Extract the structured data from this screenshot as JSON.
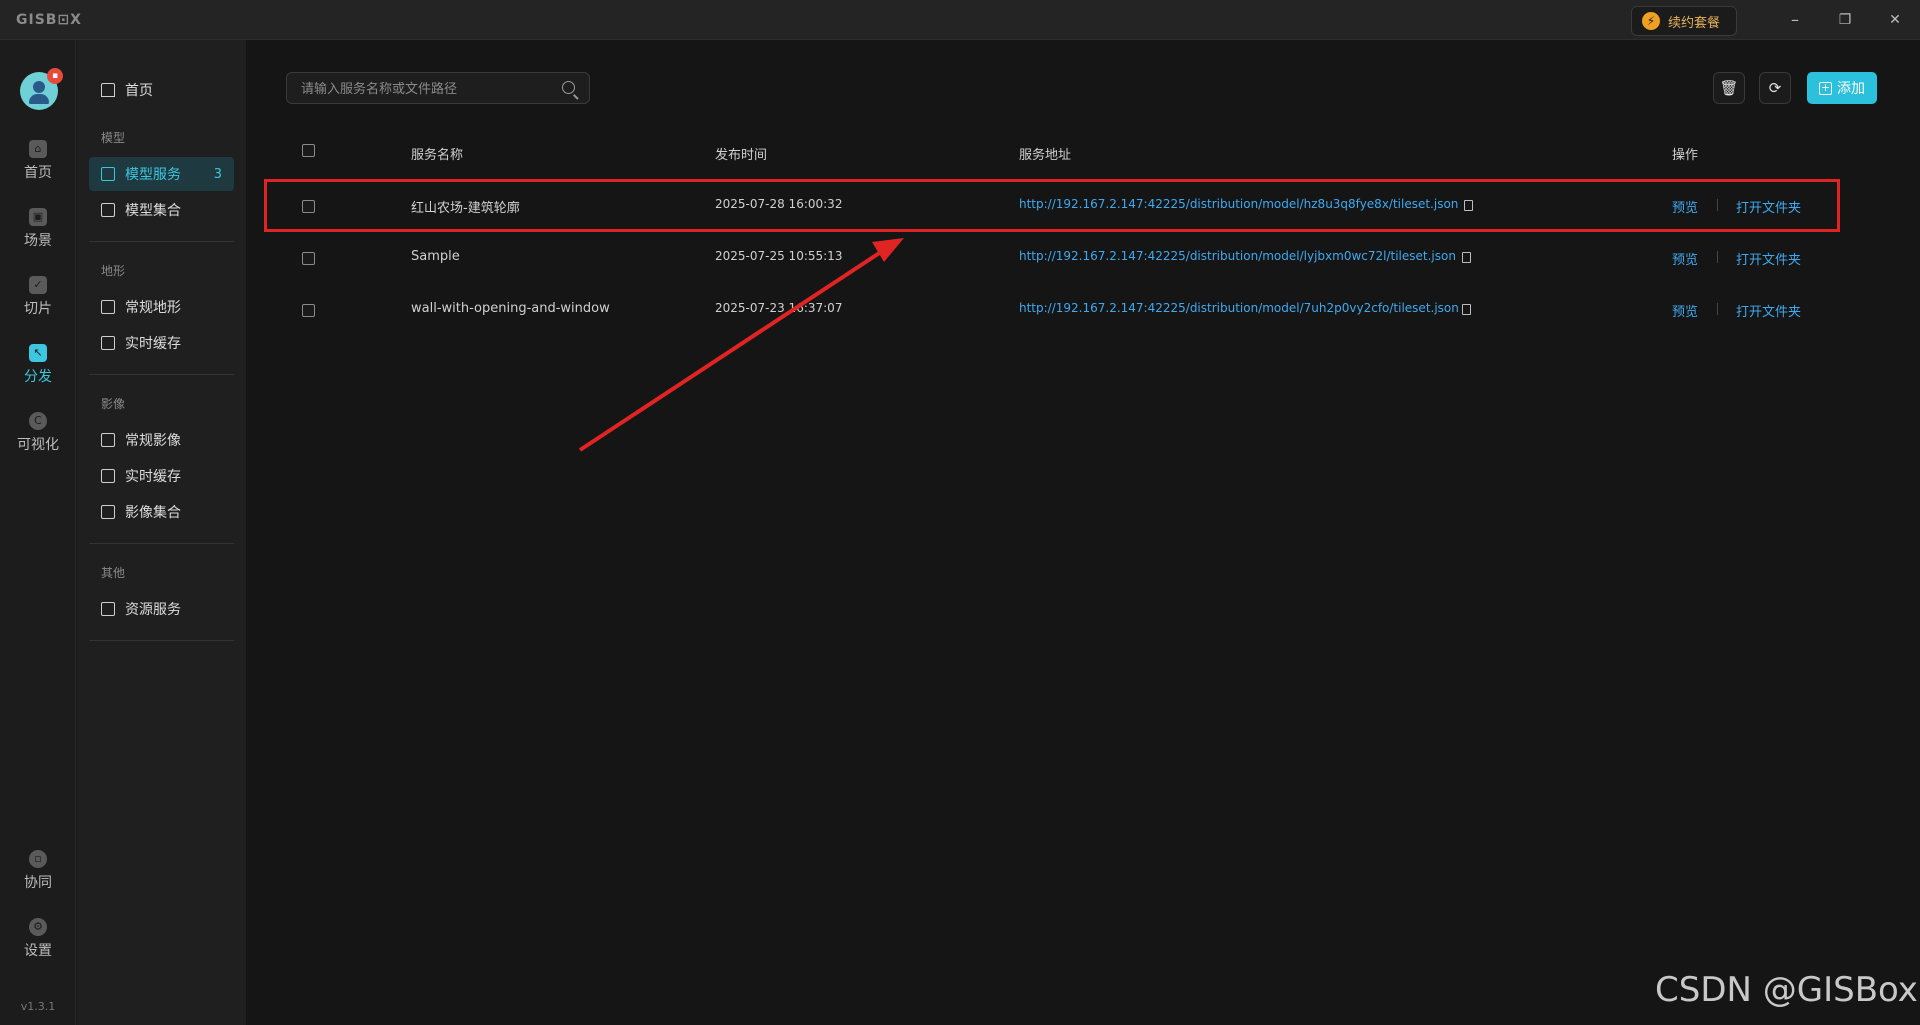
{
  "app": {
    "logo": "GISB⊡X",
    "version": "v1.3.1",
    "renew_label": "续约套餐",
    "window_controls": {
      "minimize": "–",
      "restore": "❐",
      "close": "✕"
    }
  },
  "rail": {
    "items": [
      {
        "label": "首页",
        "icon": "home-icon"
      },
      {
        "label": "场景",
        "icon": "cube-icon"
      },
      {
        "label": "切片",
        "icon": "slice-icon"
      },
      {
        "label": "分发",
        "icon": "distribute-icon",
        "active": true
      },
      {
        "label": "可视化",
        "icon": "visual-icon"
      },
      {
        "label": "协同",
        "icon": "lock-icon"
      },
      {
        "label": "设置",
        "icon": "gear-icon"
      }
    ],
    "avatar_badge": "▪"
  },
  "sidebar": {
    "home_label": "首页",
    "groups": [
      {
        "label": "模型",
        "items": [
          {
            "label": "模型服务",
            "count": "3",
            "active": true
          },
          {
            "label": "模型集合"
          }
        ]
      },
      {
        "label": "地形",
        "items": [
          {
            "label": "常规地形"
          },
          {
            "label": "实时缓存"
          }
        ]
      },
      {
        "label": "影像",
        "items": [
          {
            "label": "常规影像"
          },
          {
            "label": "实时缓存"
          },
          {
            "label": "影像集合"
          }
        ]
      },
      {
        "label": "其他",
        "items": [
          {
            "label": "资源服务"
          }
        ]
      }
    ]
  },
  "toolbar": {
    "search_placeholder": "请输入服务名称或文件路径",
    "delete_icon": "🗑",
    "refresh_icon": "⟳",
    "add_label": "添加"
  },
  "table": {
    "headers": [
      "服务名称",
      "发布时间",
      "服务地址",
      "操作"
    ],
    "rows": [
      {
        "name": "红山农场-建筑轮廓",
        "time": "2025-07-28 16:00:32",
        "url": "http://192.167.2.147:42225/distribution/model/hz8u3q8fye8x/tileset.json",
        "preview": "预览",
        "open": "打开文件夹"
      },
      {
        "name": "Sample",
        "time": "2025-07-25 10:55:13",
        "url": "http://192.167.2.147:42225/distribution/model/lyjbxm0wc72l/tileset.json",
        "preview": "预览",
        "open": "打开文件夹"
      },
      {
        "name": "wall-with-opening-and-window",
        "time": "2025-07-23 16:37:07",
        "url": "http://192.167.2.147:42225/distribution/model/7uh2p0vy2cfo/tileset.json",
        "preview": "预览",
        "open": "打开文件夹"
      }
    ]
  },
  "watermark": "CSDN @GISBox",
  "colors": {
    "accent": "#3cc6e0",
    "link": "#3fa9f0",
    "annotation": "#e02424"
  }
}
